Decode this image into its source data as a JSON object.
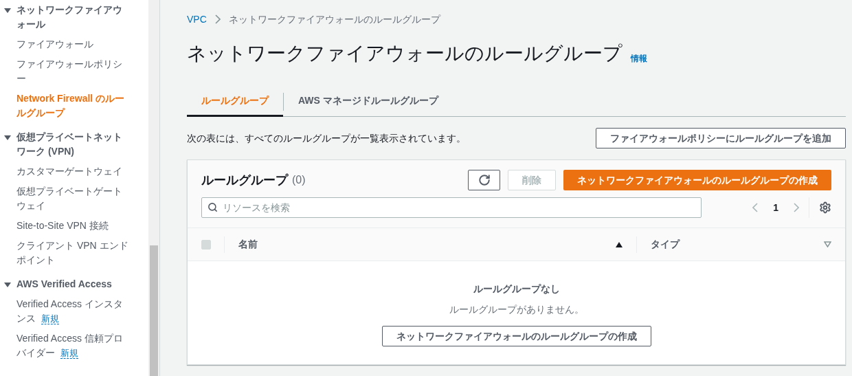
{
  "sidebar": {
    "sections": [
      {
        "title": "ネットワークファイアウォール",
        "expanded": true,
        "items": [
          {
            "label": "ファイアウォール",
            "selected": false
          },
          {
            "label": "ファイアウォールポリシー",
            "selected": false
          },
          {
            "label": "Network Firewall のルールグループ",
            "selected": true
          }
        ]
      },
      {
        "title": "仮想プライベートネットワーク (VPN)",
        "expanded": true,
        "items": [
          {
            "label": "カスタマーゲートウェイ",
            "selected": false
          },
          {
            "label": "仮想プライベートゲートウェイ",
            "selected": false
          },
          {
            "label": "Site-to-Site VPN 接続",
            "selected": false
          },
          {
            "label": "クライアント VPN エンドポイント",
            "selected": false
          }
        ]
      },
      {
        "title": "AWS Verified Access",
        "expanded": true,
        "items": [
          {
            "label": "Verified Access インスタンス",
            "selected": false,
            "badge": "新規"
          },
          {
            "label": "Verified Access 信頼プロバイダー",
            "selected": false,
            "badge": "新規"
          }
        ]
      }
    ]
  },
  "breadcrumb": [
    {
      "label": "VPC",
      "kind": "link"
    },
    {
      "label": "ネットワークファイアウォールのルールグループ",
      "kind": "current"
    }
  ],
  "title": "ネットワークファイアウォールのルールグループ",
  "info_link": "情報",
  "tabs": [
    {
      "label": "ルールグループ",
      "selected": true
    },
    {
      "label": "AWS マネージドルールグループ",
      "selected": false
    }
  ],
  "description": "次の表には、すべてのルールグループが一覧表示されています。",
  "add_button": "ファイアウォールポリシーにルールグループを追加",
  "table": {
    "title": "ルールグループ",
    "count": "(0)",
    "delete_button": {
      "label": "削除",
      "disabled": true
    },
    "create_button": "ネットワークファイアウォールのルールグループの作成",
    "search": {
      "placeholder": "リソースを検索"
    },
    "page": "1",
    "select_all": {
      "checked": false,
      "disabled": true
    },
    "columns": [
      {
        "label": "名前",
        "sorted": true
      },
      {
        "label": "タイプ",
        "sorted": false
      }
    ],
    "empty": {
      "title": "ルールグループなし",
      "message": "ルールグループがありません。",
      "button": "ネットワークファイアウォールのルールグループの作成"
    }
  }
}
